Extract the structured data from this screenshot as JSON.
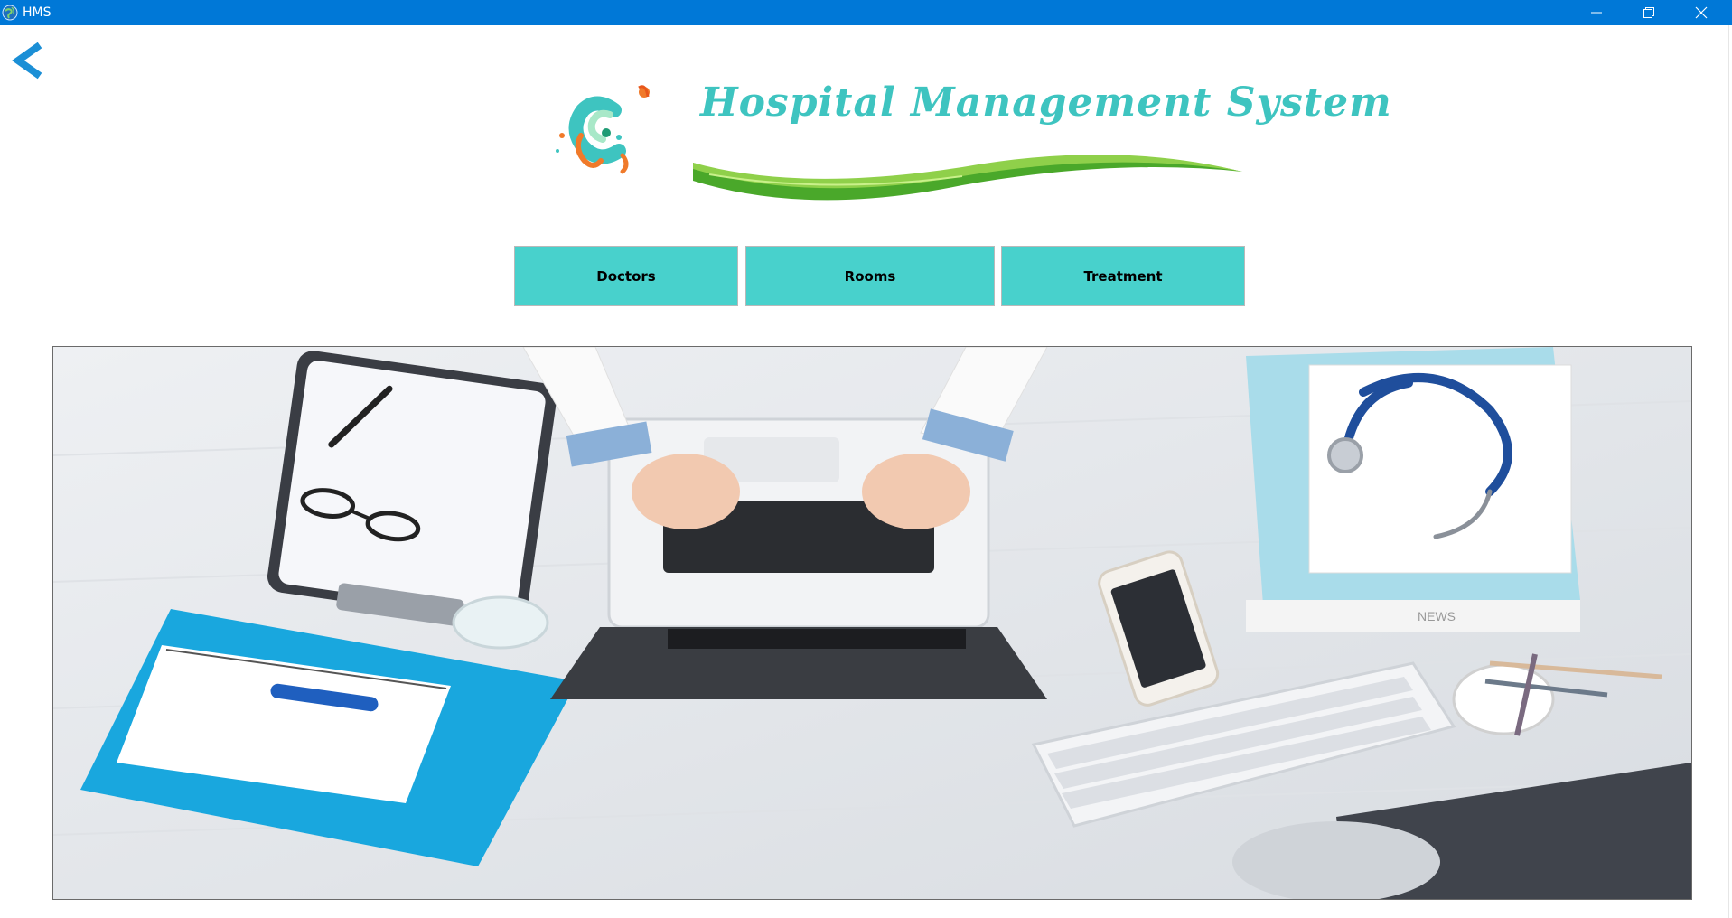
{
  "window": {
    "title": "HMS",
    "titlebar_color": "#0078d7"
  },
  "controls": {
    "back_icon": "chevron-left-icon",
    "minimize_icon": "minimize-icon",
    "maximize_icon": "restore-icon",
    "close_icon": "close-icon"
  },
  "brand": {
    "title": "Hospital Management System",
    "title_color": "#3ec4c0",
    "swoosh_color": "#5db92d"
  },
  "nav": {
    "buttons": [
      {
        "label": "Doctors"
      },
      {
        "label": "Rooms"
      },
      {
        "label": "Treatment"
      }
    ],
    "button_color": "#48d1cc"
  },
  "hero": {
    "image_description": "doctor-desk-photo",
    "paper_text": "NEWS"
  }
}
